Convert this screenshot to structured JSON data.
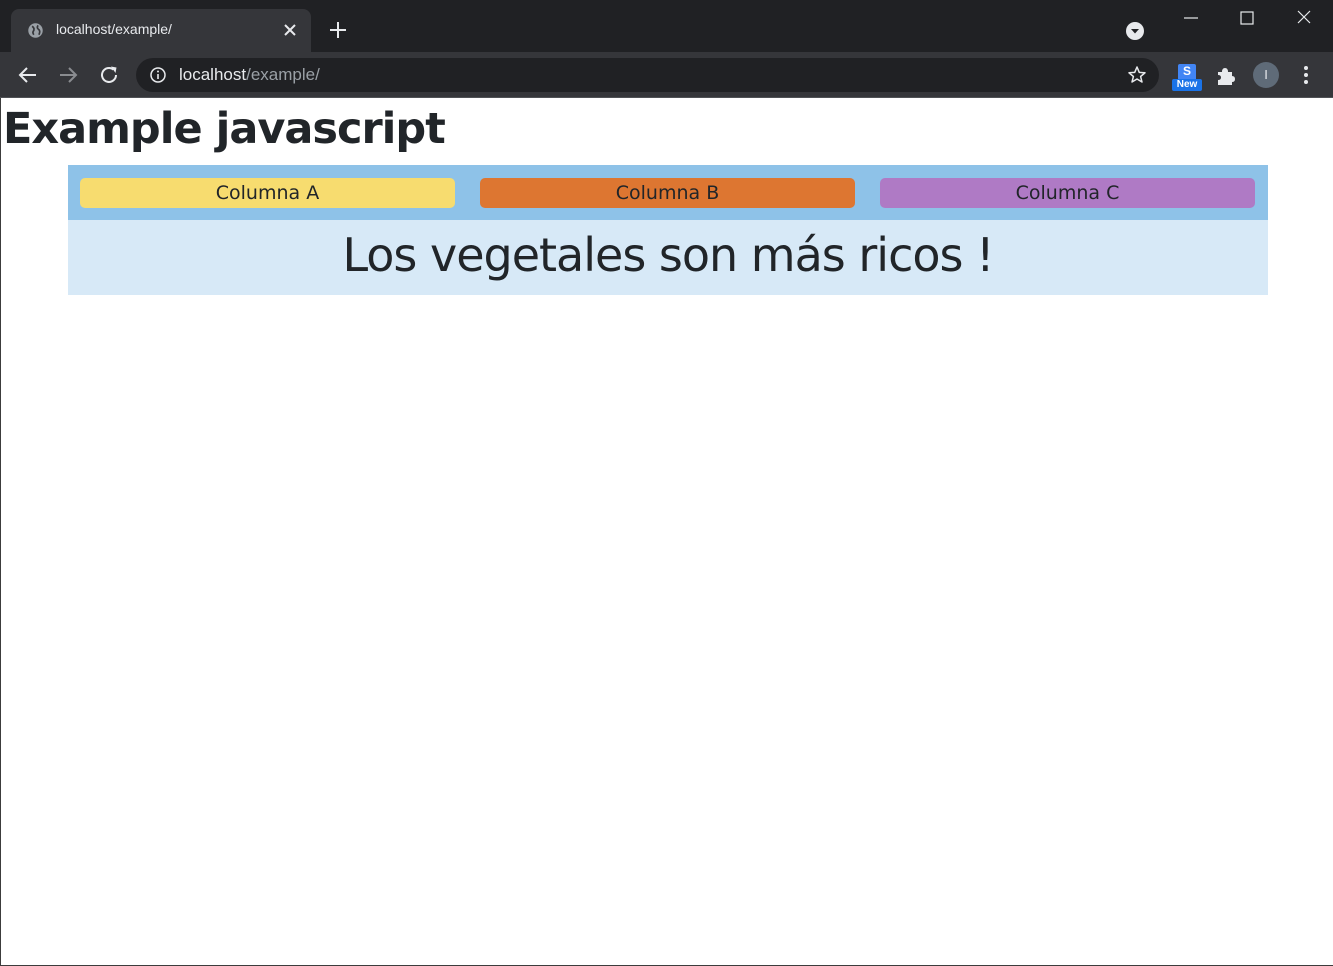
{
  "browser": {
    "tab": {
      "title": "localhost/example/"
    },
    "address": {
      "host": "localhost",
      "path": "/example/"
    },
    "extension_badge": "New",
    "extension_letter": "S",
    "profile_initial": "I",
    "icons": [
      "globe-icon",
      "close-icon",
      "plus-icon",
      "tab-search-icon",
      "minimize-icon",
      "maximize-icon",
      "window-close-icon",
      "back-arrow-icon",
      "forward-arrow-icon",
      "reload-icon",
      "info-icon",
      "star-icon",
      "puzzle-icon",
      "more-vert-icon"
    ]
  },
  "page": {
    "title": "Example javascript",
    "buttons": [
      {
        "label": "Columna A",
        "color": "#f7dc6f"
      },
      {
        "label": "Columna B",
        "color": "#dd7631"
      },
      {
        "label": "Columna C",
        "color": "#af7ac5"
      }
    ],
    "message": "Los vegetales son más ricos !",
    "colors": {
      "button_row_bg": "#8ec2e8",
      "message_bg": "#d7e9f7"
    }
  }
}
